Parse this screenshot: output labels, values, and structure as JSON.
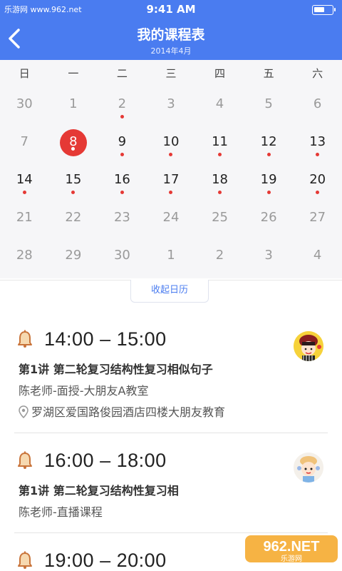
{
  "status": {
    "carrier": "乐游网 www.962.net",
    "time": "9:41 AM",
    "battery_level": 0.6
  },
  "header": {
    "title": "我的课程表",
    "subtitle": "2014年4月"
  },
  "calendar": {
    "weekdays": [
      "日",
      "一",
      "二",
      "三",
      "四",
      "五",
      "六"
    ],
    "weeks": [
      [
        {
          "d": "30",
          "m": true,
          "dot": false
        },
        {
          "d": "1",
          "m": true,
          "dot": false
        },
        {
          "d": "2",
          "m": true,
          "dot": true
        },
        {
          "d": "3",
          "m": true,
          "dot": false
        },
        {
          "d": "4",
          "m": true,
          "dot": false
        },
        {
          "d": "5",
          "m": true,
          "dot": false
        },
        {
          "d": "6",
          "m": true,
          "dot": false
        }
      ],
      [
        {
          "d": "7",
          "m": true,
          "dot": false
        },
        {
          "d": "8",
          "m": false,
          "dot": true,
          "today": true
        },
        {
          "d": "9",
          "m": false,
          "dot": true
        },
        {
          "d": "10",
          "m": false,
          "dot": true
        },
        {
          "d": "11",
          "m": false,
          "dot": true
        },
        {
          "d": "12",
          "m": false,
          "dot": true
        },
        {
          "d": "13",
          "m": false,
          "dot": true
        }
      ],
      [
        {
          "d": "14",
          "m": false,
          "dot": true
        },
        {
          "d": "15",
          "m": false,
          "dot": true
        },
        {
          "d": "16",
          "m": false,
          "dot": true
        },
        {
          "d": "17",
          "m": false,
          "dot": true
        },
        {
          "d": "18",
          "m": false,
          "dot": true
        },
        {
          "d": "19",
          "m": false,
          "dot": true
        },
        {
          "d": "20",
          "m": false,
          "dot": true
        }
      ],
      [
        {
          "d": "21",
          "m": true,
          "dot": false
        },
        {
          "d": "22",
          "m": true,
          "dot": false
        },
        {
          "d": "23",
          "m": true,
          "dot": false
        },
        {
          "d": "24",
          "m": true,
          "dot": false
        },
        {
          "d": "25",
          "m": true,
          "dot": false
        },
        {
          "d": "26",
          "m": true,
          "dot": false
        },
        {
          "d": "27",
          "m": true,
          "dot": false
        }
      ],
      [
        {
          "d": "28",
          "m": true,
          "dot": false
        },
        {
          "d": "29",
          "m": true,
          "dot": false
        },
        {
          "d": "30",
          "m": true,
          "dot": false
        },
        {
          "d": "1",
          "m": true,
          "dot": false
        },
        {
          "d": "2",
          "m": true,
          "dot": false
        },
        {
          "d": "3",
          "m": true,
          "dot": false
        },
        {
          "d": "4",
          "m": true,
          "dot": false
        }
      ]
    ],
    "collapse_label": "收起日历"
  },
  "courses": [
    {
      "time": "14:00 – 15:00",
      "name": "第1讲 第二轮复习结构性复习相似句子",
      "teacher": "陈老师-面授-大朋友A教室",
      "address": "罗湖区爱国路俊园酒店四楼大朋友教育",
      "avatar": "girl-avatar-icon"
    },
    {
      "time": "16:00 – 18:00",
      "name": "第1讲 第二轮复习结构性复习相",
      "teacher": "陈老师-直播课程",
      "address": "",
      "avatar": "child-avatar-icon"
    },
    {
      "time": "19:00 – 20:00",
      "name": "",
      "teacher": "",
      "address": "",
      "avatar": "avatar-icon"
    }
  ],
  "colors": {
    "accent": "#4a7cf0",
    "today": "#e53935",
    "dot": "#e53935",
    "bell": "#c9743a"
  },
  "watermark": {
    "text": "962.NET",
    "subtext": "乐游网"
  }
}
